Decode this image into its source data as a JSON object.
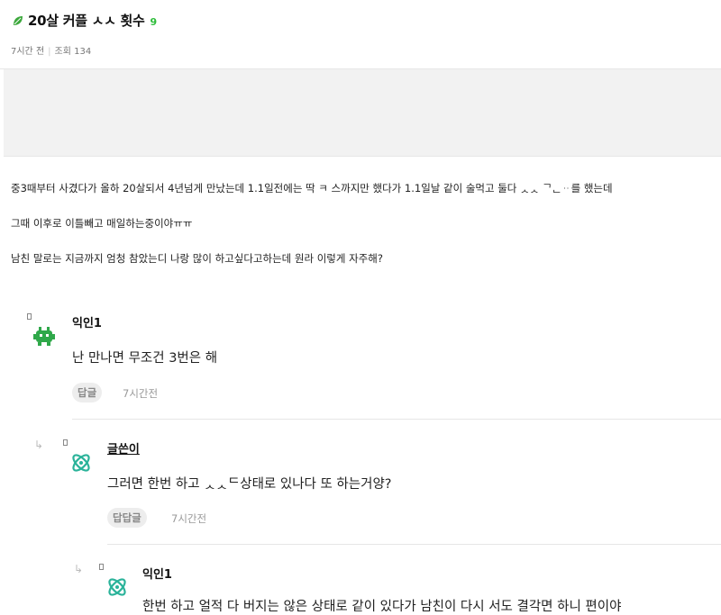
{
  "post": {
    "title": "20살 커플 ㅅㅅ 횟수",
    "comment_count": "9",
    "time": "7시간 전",
    "views": "조회 134",
    "body": [
      "중3때부터 사겼다가 올하 20살되서 4년넘게 만났는데 1.1일전에는 딱 ㅋ 스까지만 했다가 1.1일날 같이 술먹고 둘다 ᆺᆺ ᄀᆫᆢ를 했는데",
      "그때 이후로 이틀빼고 매일하는중이야ㅠㅠ",
      "남친 말로는 지금까지 엄청 참았는디 나랑 많이 하고싶다고하는데 원라 이렇게 자주해?"
    ]
  },
  "comments": [
    {
      "name": "익인1",
      "text": "난 만나면 무조건 3번은 해",
      "reply_label": "답글",
      "time": "7시간전",
      "avatar": "alien-icon"
    },
    {
      "name": "글쓴이",
      "text": "그러면 한번 하고 ᆺᆺᄃ상태로 있나다 또 하는거양?",
      "reply_label": "답답글",
      "time": "7시간전",
      "avatar": "atom-icon"
    },
    {
      "name": "익인1",
      "text": "한번 하고 얼적 다 버지는 않은 상태로 같이 있다가 남친이 다시 서도 결각면 하니 편이야",
      "avatar": "atom-icon"
    }
  ],
  "colors": {
    "accent_green": "#2dbd3a",
    "leaf_green": "#3ca83c",
    "avatar_green": "#2fa84a",
    "avatar_teal": "#2bb39a"
  }
}
